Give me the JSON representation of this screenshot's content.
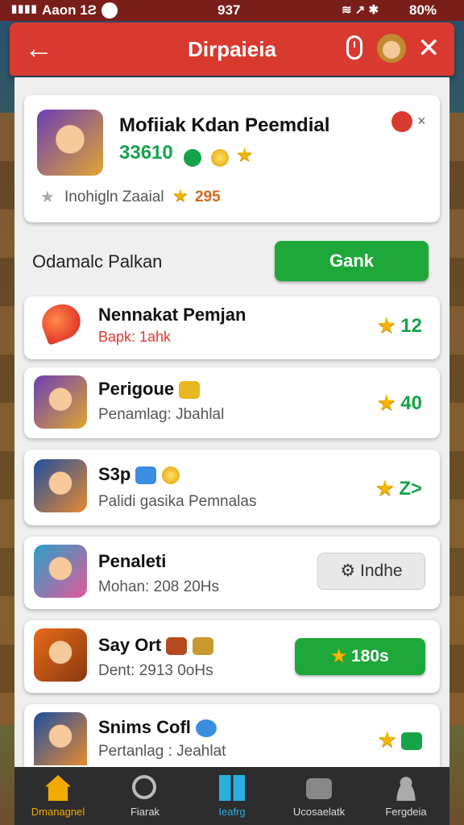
{
  "status": {
    "left": "Aaon 1Ƨ",
    "center": "937",
    "right": "80%"
  },
  "header": {
    "title": "Dirpaieia",
    "back_icon": "arrow-left-icon",
    "close_icon": "close-icon",
    "color": "#d93a2f"
  },
  "profile": {
    "name": "Mofiiak Kdan Peemdial",
    "score": "33610",
    "stat_label": "Inohigln Zaaial",
    "stat_value": "295",
    "close_mark": "×"
  },
  "section": {
    "title": "Odamalc Palkan",
    "button": "Gank"
  },
  "items": [
    {
      "name": "Nennakat Pemjan",
      "sub": "Bapk: 1ahk",
      "trail": "12",
      "icon": "heart-balloon-icon"
    },
    {
      "name": "Perigoue",
      "sub": "Penamlag: Jbahlal",
      "trail": "40",
      "icon": "hero-avatar-icon"
    },
    {
      "name": "S3p",
      "sub": "Palidi gasika Pemnalas",
      "trail": "Z>",
      "icon": "hero-avatar-icon"
    },
    {
      "name": "Penaleti",
      "sub": "Mohan: 208 20Hs",
      "button": "Indhe",
      "icon": "hero-avatar-icon"
    },
    {
      "name": "Say Ort",
      "sub": "Dent: 2913 0oHs",
      "button": "180s",
      "icon": "hero-avatar-icon"
    },
    {
      "name": "Snims Cofl",
      "sub": "Pertanlag : Jeahlat",
      "icon": "hero-avatar-icon"
    }
  ],
  "nav": [
    {
      "label": "Dmanagnel",
      "icon": "home-icon",
      "active": true
    },
    {
      "label": "Fiarak",
      "icon": "search-icon"
    },
    {
      "label": "Ieafrg",
      "icon": "leaderboard-icon"
    },
    {
      "label": "Ucosaelatk",
      "icon": "camera-icon"
    },
    {
      "label": "Fergdeia",
      "icon": "profile-icon"
    }
  ],
  "colors": {
    "accent_green": "#1ea83a",
    "header_red": "#d93a2f",
    "nav_bg": "#2d2d2d"
  }
}
